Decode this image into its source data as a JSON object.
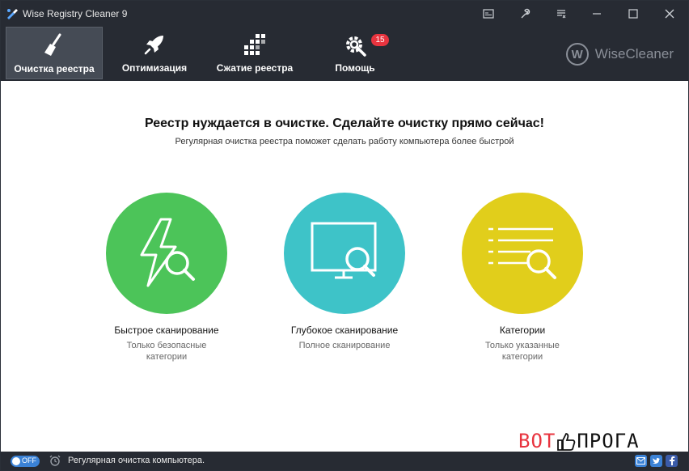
{
  "titlebar": {
    "app_title": "Wise Registry Cleaner 9",
    "buttons": [
      "menu-icon",
      "settings-wrench-icon",
      "options-list-icon",
      "minimize-icon",
      "maximize-icon",
      "close-icon"
    ]
  },
  "nav": {
    "items": [
      {
        "label": "Очистка реестра",
        "icon": "broom-icon",
        "active": true
      },
      {
        "label": "Оптимизация",
        "icon": "rocket-icon",
        "active": false
      },
      {
        "label": "Сжатие реестра",
        "icon": "compress-blocks-icon",
        "active": false
      },
      {
        "label": "Помощь",
        "icon": "gear-wrench-icon",
        "active": false,
        "badge": "15"
      }
    ]
  },
  "brand": {
    "logo_letter": "W",
    "name": "WiseCleaner"
  },
  "main": {
    "headline": "Реестр нуждается в очистке. Сделайте очистку прямо сейчас!",
    "subline": "Регулярная очистка реестра поможет сделать работу компьютера более быстрой"
  },
  "scans": [
    {
      "title": "Быстрое сканирование",
      "desc": "Только безопасные категории",
      "color": "#4cc459",
      "icon": "lightning-search-icon"
    },
    {
      "title": "Глубокое сканирование",
      "desc": "Полное сканирование",
      "color": "#3ec3c8",
      "icon": "monitor-search-icon"
    },
    {
      "title": "Категории",
      "desc": "Только указанные категории",
      "color": "#e1ce1b",
      "icon": "list-search-icon"
    }
  ],
  "statusbar": {
    "toggle_label": "OFF",
    "text": "Регулярная очистка компьютера.",
    "social": [
      "mail-icon",
      "twitter-icon",
      "facebook-icon"
    ]
  },
  "watermark": {
    "part1": "BOT",
    "part2": "ПРОГА"
  },
  "colors": {
    "dark": "#272b33",
    "active_tab": "#454b55",
    "badge": "#e8343f",
    "toggle": "#3b82d6"
  }
}
